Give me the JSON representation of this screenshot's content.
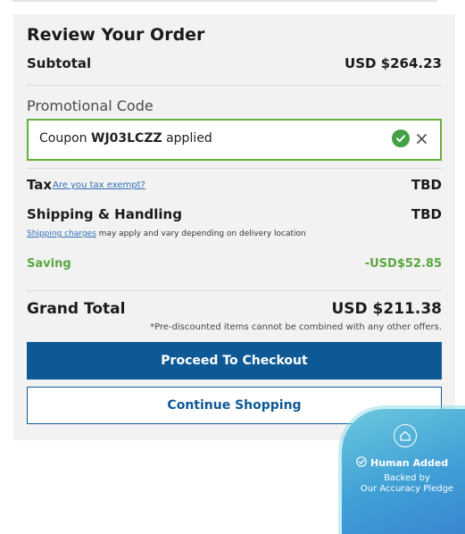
{
  "summary": {
    "title": "Review Your Order",
    "subtotal_label": "Subtotal",
    "subtotal_value": "USD $264.23"
  },
  "promo": {
    "label": "Promotional Code",
    "prefix": "Coupon",
    "code": "WJ03LCZZ",
    "suffix": "applied",
    "status_icon": "check-circle-icon",
    "remove_icon": "close-icon",
    "accent_color": "#63b03a"
  },
  "tax": {
    "label": "Tax",
    "link": "Are you tax exempt?",
    "value": "TBD"
  },
  "shipping": {
    "label": "Shipping & Handling",
    "value": "TBD",
    "note_link": "Shipping charges",
    "note_text": "may apply and vary depending on delivery location"
  },
  "saving": {
    "label": "Saving",
    "value": "-USD$52.85",
    "color": "#5ba640"
  },
  "grand_total": {
    "label": "Grand Total",
    "value": "USD $211.38",
    "note": "*Pre-discounted items cannot be combined with any other offers."
  },
  "actions": {
    "checkout_label": "Proceed To Checkout",
    "continue_label": "Continue Shopping",
    "primary_color": "#0d5995"
  },
  "badge": {
    "logo_icon": "house-icon",
    "check_icon": "check-circle-outline-icon",
    "title": "Human Added",
    "line1": "Backed by",
    "line2": "Our Accuracy Pledge"
  }
}
